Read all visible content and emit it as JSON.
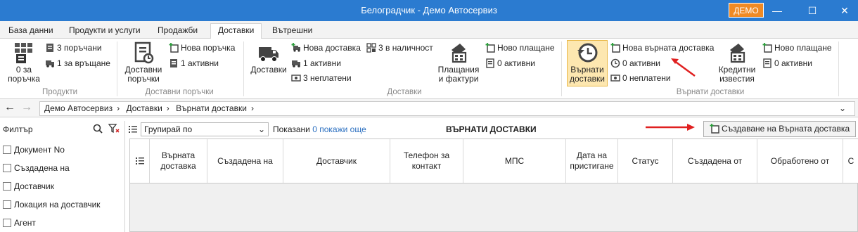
{
  "window": {
    "title": "Белоградчик - Демо Автосервиз",
    "badge": "ДЕМО"
  },
  "tabs": [
    {
      "label": "База данни"
    },
    {
      "label": "Продукти и услуги"
    },
    {
      "label": "Продажби"
    },
    {
      "label": "Доставки",
      "active": true
    },
    {
      "label": "Вътрешни"
    }
  ],
  "ribbon": {
    "products": {
      "big": "0 за поръчка",
      "ordered": "3 поръчани",
      "to_return": "1 за връщане",
      "group": "Продукти"
    },
    "delivery_orders": {
      "big": "Доставни поръчки",
      "new": "Нова поръчка",
      "active": "1 активни",
      "group": "Доставни поръчки"
    },
    "deliveries": {
      "big": "Доставки",
      "new": "Нова доставка",
      "active": "1 активни",
      "unpaid": "3 неплатени",
      "in_stock": "3 в наличност",
      "payments": "Плащания и фактури",
      "new_payment": "Ново плащане",
      "payments_active": "0 активни",
      "group": "Доставки"
    },
    "returns": {
      "big": "Върнати доставки",
      "new": "Нова върната доставка",
      "active": "0 активни",
      "unpaid": "0 неплатени",
      "credit": "Кредитни известия",
      "new_payment": "Ново плащане",
      "payments_active": "0 активни",
      "group": "Върнати доставки"
    }
  },
  "breadcrumb": [
    "Демо Автосервиз",
    "Доставки",
    "Върнати доставки"
  ],
  "filter": {
    "title": "Филтър",
    "items": [
      "Документ No",
      "Създадена на",
      "Доставчик",
      "Локация на доставчик",
      "Агент"
    ]
  },
  "toolbar": {
    "group_by": "Групирай по",
    "shown_label": "Показани",
    "shown_count": "0",
    "show_more": "покажи още",
    "heading": "ВЪРНАТИ ДОСТАВКИ",
    "create_label": "Създаване на Върната доставка"
  },
  "grid": {
    "columns": [
      "Върната доставка",
      "Създадена на",
      "Доставчик",
      "Телефон за контакт",
      "МПС",
      "Дата на пристигане",
      "Статус",
      "Създадена от",
      "Обработено от",
      "С"
    ]
  },
  "colors": {
    "titlebar": "#2b7bd0",
    "badge": "#f08a24",
    "highlight": "#fde7b0",
    "arrow": "#e02020"
  }
}
